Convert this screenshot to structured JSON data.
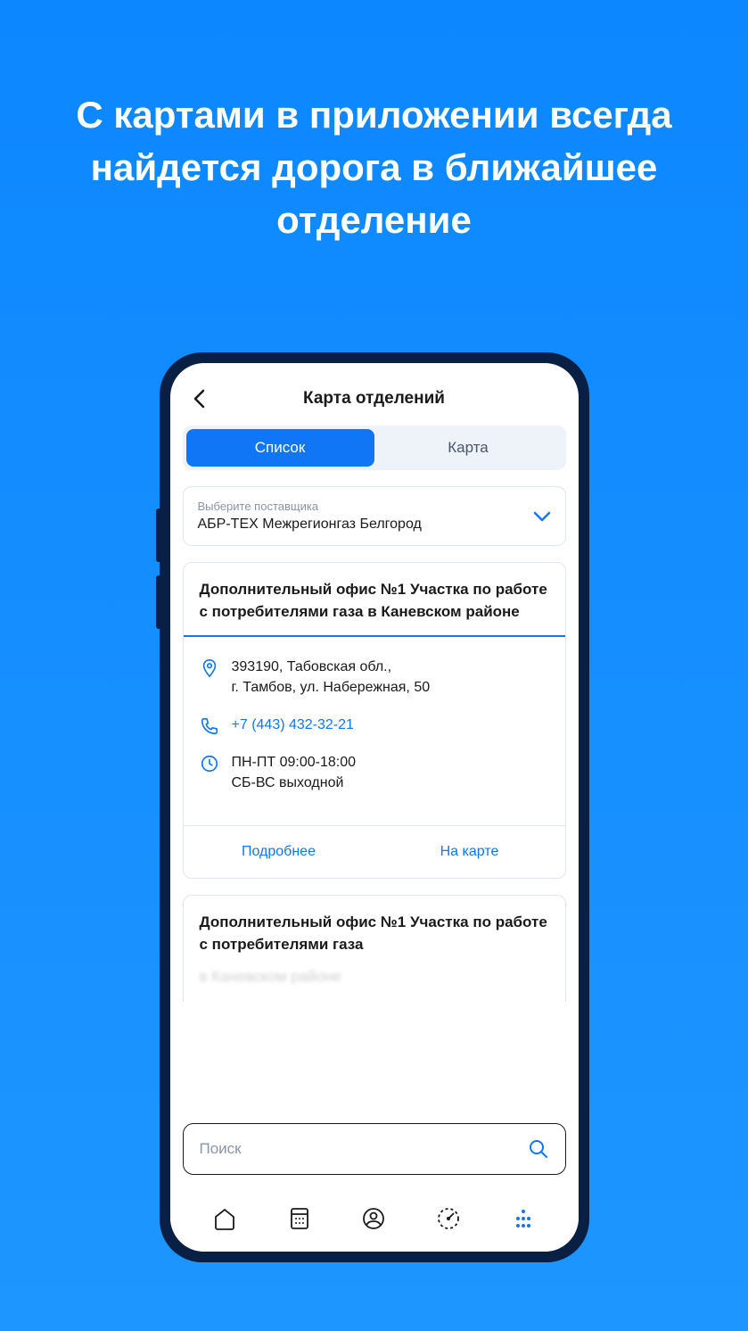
{
  "promo": "С картами в приложении всегда найдется дорога в ближайшее отделение",
  "header": {
    "title": "Карта отделений"
  },
  "segmented": {
    "list": "Список",
    "map": "Карта"
  },
  "provider": {
    "label": "Выберите поставщика",
    "value": "АБР-ТЕХ Межрегионгаз Белгород"
  },
  "card1": {
    "title": "Дополнительный офис №1 Участка по работе с потребителями газа в Каневском районе",
    "address_line1": "393190, Табовская обл.,",
    "address_line2": "г. Тамбов, ул. Набережная, 50",
    "phone": "+7 (443) 432-32-21",
    "hours_line1": "ПН-ПТ 09:00-18:00",
    "hours_line2": "СБ-ВС выходной",
    "action_details": "Подробнее",
    "action_map": "На карте"
  },
  "card2": {
    "title": "Дополнительный офис №1 Участка по работе с потребителями газа",
    "faded": "в Каневском районе"
  },
  "search": {
    "placeholder": "Поиск"
  }
}
